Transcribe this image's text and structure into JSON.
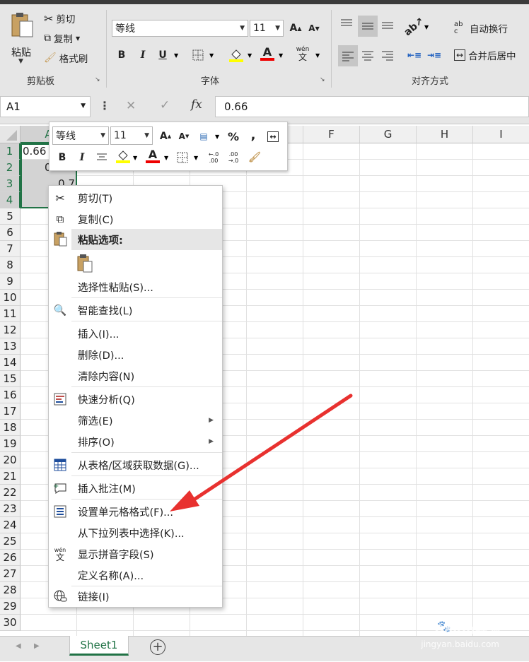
{
  "ribbon": {
    "clipboard": {
      "paste": "粘贴",
      "cut": "剪切",
      "copy": "复制",
      "format_painter": "格式刷",
      "group_label": "剪贴板"
    },
    "font": {
      "font_name": "等线",
      "font_size": "11",
      "bold": "B",
      "italic": "I",
      "underline": "U",
      "grow": "A",
      "shrink": "A",
      "font_color": "A",
      "phonetic": "wén",
      "phonetic_char": "文",
      "group_label": "字体"
    },
    "alignment": {
      "wrap_text": "自动换行",
      "merge_center": "合并后居中",
      "group_label": "对齐方式",
      "wrap_glyph": "ab c"
    }
  },
  "formula_bar": {
    "name_box": "A1",
    "cancel": "✕",
    "enter": "✓",
    "fx": "fx",
    "formula": "0.66"
  },
  "sheet": {
    "columns": [
      "A",
      "B",
      "C",
      "D",
      "E",
      "F",
      "G",
      "H",
      "I"
    ],
    "rows": [
      "1",
      "2",
      "3",
      "4",
      "5",
      "6",
      "7",
      "8",
      "9",
      "10",
      "11",
      "12",
      "13",
      "14",
      "15",
      "16",
      "17",
      "18",
      "19",
      "20",
      "21",
      "22",
      "23",
      "24",
      "25",
      "26",
      "27",
      "28",
      "29",
      "30"
    ],
    "cells": {
      "a1": "0.66",
      "a2": "0.902",
      "a3": "0.7"
    }
  },
  "mini_toolbar": {
    "font_name": "等线",
    "font_size": "11",
    "bold": "B",
    "italic": "I",
    "percent": "%",
    "comma": ",",
    "inc_decimal": "←.0 .00",
    "dec_decimal": ".00 →.0"
  },
  "context_menu": {
    "cut": "剪切(T)",
    "copy": "复制(C)",
    "paste_options": "粘贴选项:",
    "paste_special": "选择性粘贴(S)...",
    "smart_lookup": "智能查找(L)",
    "insert": "插入(I)...",
    "delete": "删除(D)...",
    "clear_contents": "清除内容(N)",
    "quick_analysis": "快速分析(Q)",
    "filter": "筛选(E)",
    "sort": "排序(O)",
    "get_data": "从表格/区域获取数据(G)...",
    "insert_comment": "插入批注(M)",
    "format_cells": "设置单元格格式(F)...",
    "pick_from_list": "从下拉列表中选择(K)...",
    "show_phonetic": "显示拼音字段(S)",
    "define_name": "定义名称(A)...",
    "link": "链接(I)"
  },
  "tabs": {
    "sheet1": "Sheet1",
    "add": "+"
  },
  "watermark": {
    "logo": "Baidu经验",
    "url": "jingyan.baidu.com"
  },
  "colors": {
    "excel_green": "#217346",
    "annotation_arrow": "#e8312f"
  }
}
